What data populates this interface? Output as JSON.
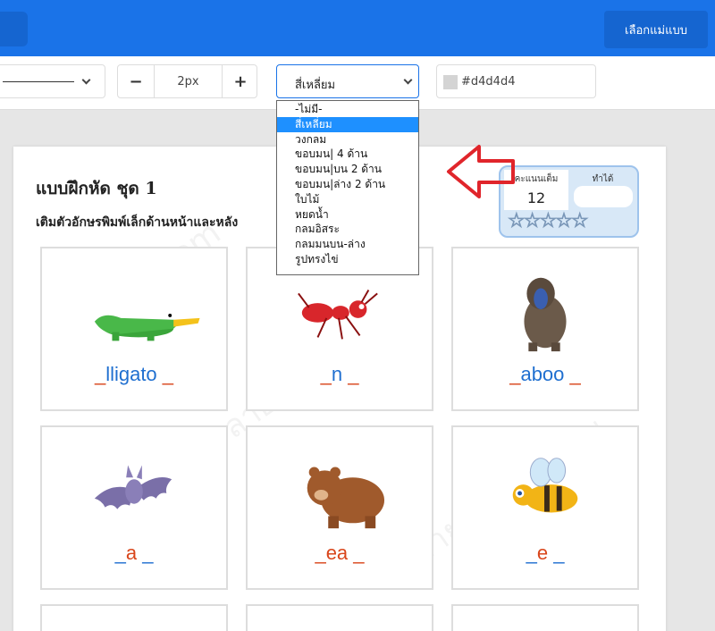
{
  "header": {
    "template_button": "เลือกแม่แบบ"
  },
  "toolbar": {
    "border_width": "2px",
    "minus": "−",
    "plus": "+",
    "shape_value": "สี่เหลี่ยม",
    "color_value": "#d4d4d4"
  },
  "dropdown": {
    "options": [
      "-ไม่มี-",
      "สี่เหลี่ยม",
      "วงกลม",
      "ขอบมน| 4 ด้าน",
      "ขอบมน|บน 2 ด้าน",
      "ขอบมน|ล่าง 2 ด้าน",
      "ใบไม้",
      "หยดน้ำ",
      "กลมอิสระ",
      "กลมมนบน-ล่าง",
      "รูปทรงไข่"
    ],
    "selected": "สี่เหลี่ยม"
  },
  "worksheet": {
    "title": "แบบฝึกหัด ชุด 1",
    "instruction": "เติมตัวอักษรพิมพ์เล็กด้านหน้าและหลัง",
    "score": {
      "full_label": "คะแนนเต็ม",
      "full_value": "12",
      "got_label": "ทำได้"
    },
    "stars": "☆☆☆☆☆"
  },
  "cards": [
    {
      "name": "alligator",
      "word": [
        "_",
        "lligato",
        "_"
      ]
    },
    {
      "name": "ant",
      "word": [
        "_",
        "n",
        "_"
      ]
    },
    {
      "name": "baboon",
      "word": [
        "_",
        "aboo",
        "_"
      ]
    },
    {
      "name": "bat",
      "word": [
        "_",
        "a",
        "_"
      ]
    },
    {
      "name": "bear",
      "word": [
        "_",
        "ea",
        "_"
      ]
    },
    {
      "name": "bee",
      "word": [
        "_",
        "e",
        "_"
      ]
    }
  ],
  "watermarks": [
    "engdict.com",
    "ลายน้ำละหายาย"
  ],
  "colors": {
    "header_blue": "#1a73e8",
    "dropdown_selected": "#1e90ff",
    "word_blue": "#1f6fd0",
    "word_orange": "#d9461b",
    "arrow_red": "#e0252b"
  }
}
